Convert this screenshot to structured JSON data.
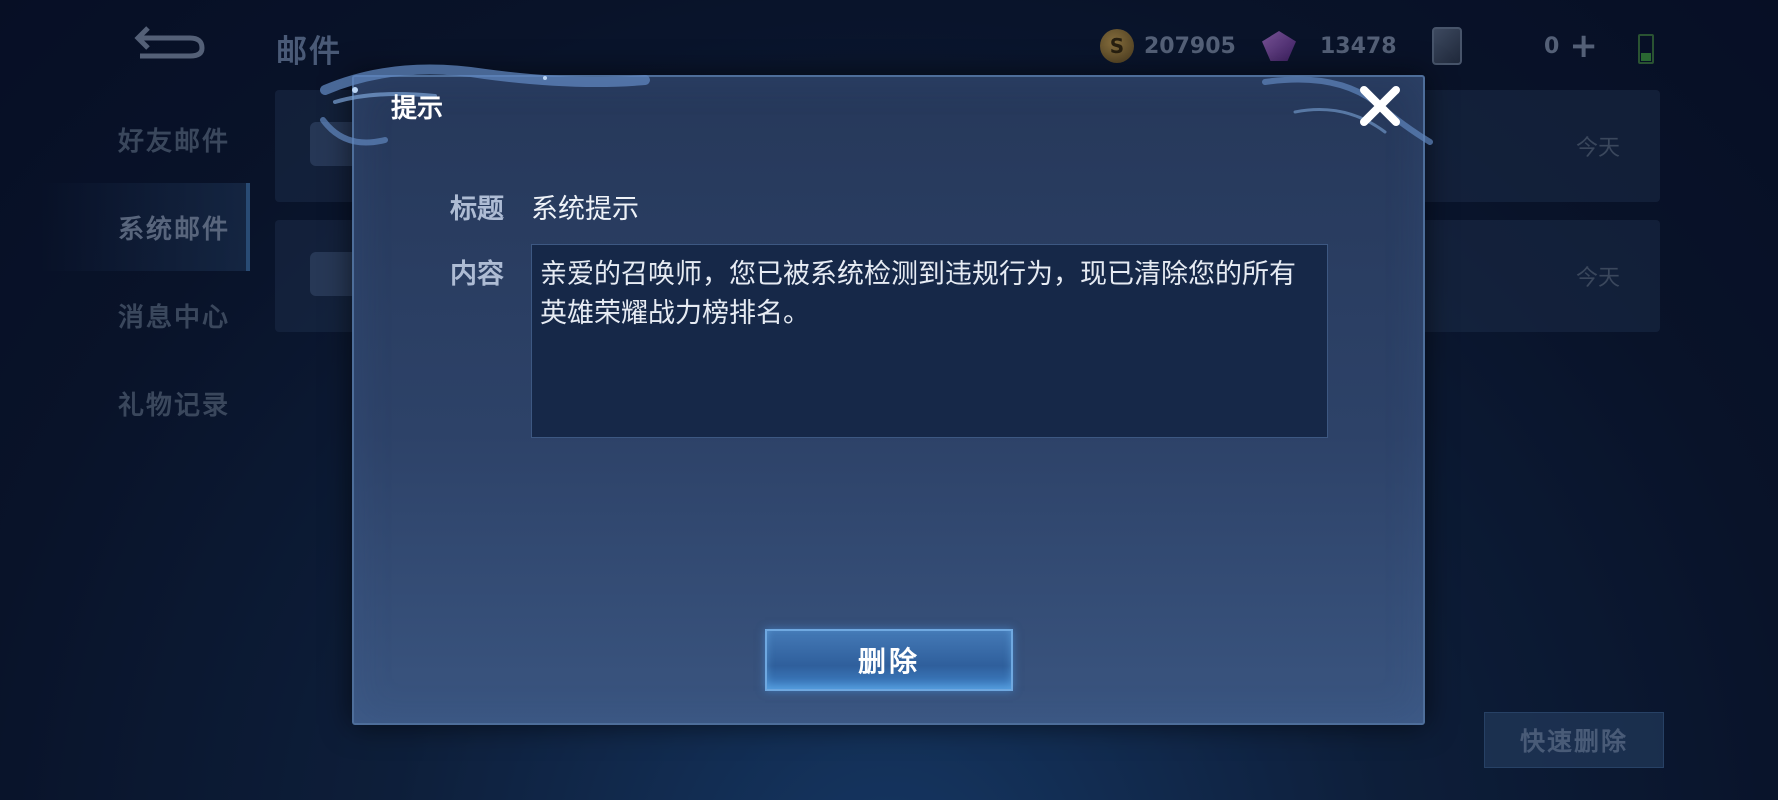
{
  "header": {
    "title": "邮件",
    "gold": "207905",
    "diamonds": "13478",
    "tickets": "0"
  },
  "sidebar": {
    "items": [
      {
        "label": "好友邮件"
      },
      {
        "label": "系统邮件"
      },
      {
        "label": "消息中心"
      },
      {
        "label": "礼物记录"
      }
    ]
  },
  "mail_list": {
    "rows": [
      {
        "date": "今天"
      },
      {
        "date": "今天"
      }
    ],
    "quick_delete_label": "快速删除"
  },
  "dialog": {
    "title": "提示",
    "subject_label": "标题",
    "subject_value": "系统提示",
    "content_label": "内容",
    "content_value": "亲爱的召唤师，您已被系统检测到违规行为，现已清除您的所有英雄荣耀战力榜排名。",
    "delete_label": "删除"
  },
  "icons": {
    "back": "back-arrow-icon",
    "gold": "gold-coin-icon",
    "diamond": "diamond-icon",
    "ticket": "ticket-card-icon",
    "add": "plus-icon",
    "close": "close-icon"
  }
}
